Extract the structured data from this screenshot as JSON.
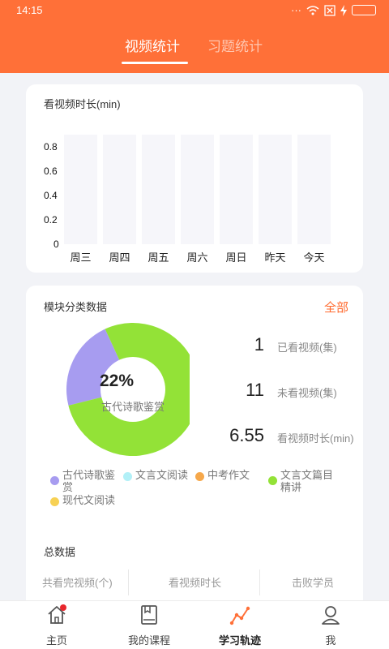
{
  "status_bar": {
    "time": "14:15",
    "dots": "···"
  },
  "tabs": [
    {
      "label": "视频统计",
      "active": true
    },
    {
      "label": "习题统计",
      "active": false
    }
  ],
  "watch_time": {
    "title": "看视频时长(min)",
    "chart_data": {
      "type": "bar",
      "title": "看视频时长(min)",
      "categories": [
        "周三",
        "周四",
        "周五",
        "周六",
        "周日",
        "昨天",
        "今天"
      ],
      "values": [
        0,
        0,
        0,
        0,
        0,
        0,
        0
      ],
      "y_ticks": [
        "0.8",
        "0.6",
        "0.4",
        "0.2",
        "0"
      ],
      "ylim": [
        0,
        0.8
      ],
      "grid": false
    }
  },
  "modules": {
    "title": "模块分类数据",
    "all_link": "全部",
    "donut_center": {
      "percent": "22%",
      "label": "古代诗歌鉴赏"
    },
    "chart_data": {
      "type": "pie",
      "donut": true,
      "slices": [
        {
          "name": "古代诗歌鉴赏",
          "value": 22,
          "color": "#a79cf0"
        },
        {
          "name": "文言文篇目精讲",
          "value": 78,
          "color": "#93e237"
        }
      ]
    },
    "stats": [
      {
        "value": "1",
        "label": "已看视频(集)"
      },
      {
        "value": "11",
        "label": "未看视频(集)"
      },
      {
        "value": "6.55",
        "label": "看视频时长(min)"
      }
    ],
    "legend": [
      {
        "label_lines": [
          "古代诗歌鉴",
          "赏"
        ],
        "color": "#a79cf0"
      },
      {
        "label_lines": [
          "文言文阅读"
        ],
        "color": "#b2f0f7"
      },
      {
        "label_lines": [
          "中考作文"
        ],
        "color": "#f6a84b"
      },
      {
        "label_lines": [
          "文言文篇目",
          "精讲"
        ],
        "color": "#93e237"
      },
      {
        "label_lines": [
          "现代文阅读"
        ],
        "color": "#f7d154"
      }
    ]
  },
  "totals": {
    "title": "总数据",
    "columns": [
      "共看完视频(个)",
      "看视频时长",
      "击败学员"
    ]
  },
  "bottom_nav": [
    {
      "label": "主页",
      "icon": "home-icon",
      "badge": true
    },
    {
      "label": "我的课程",
      "icon": "book-icon"
    },
    {
      "label": "学习轨迹",
      "icon": "trend-icon",
      "active": true
    },
    {
      "label": "我",
      "icon": "user-icon"
    }
  ],
  "colors": {
    "accent": "#ff7038",
    "link": "#ff6a2e",
    "badge": "#e8262c"
  }
}
